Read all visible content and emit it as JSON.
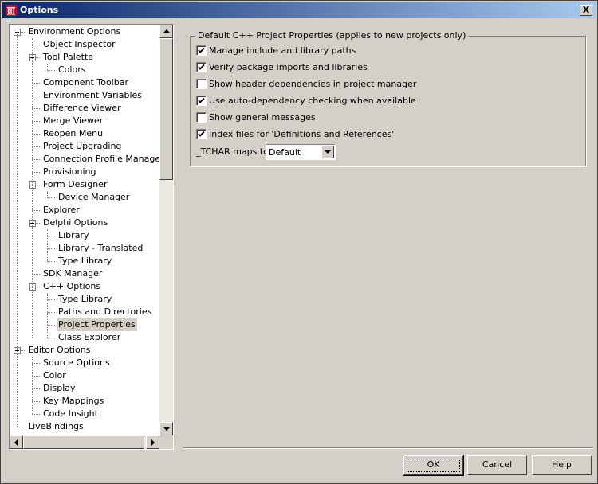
{
  "window": {
    "title": "Options",
    "close_label": "X"
  },
  "tree": {
    "items": [
      {
        "label": "Environment Options",
        "level": 0,
        "expanded": true
      },
      {
        "label": "Object Inspector",
        "level": 1
      },
      {
        "label": "Tool Palette",
        "level": 1,
        "expanded": true
      },
      {
        "label": "Colors",
        "level": 2
      },
      {
        "label": "Component Toolbar",
        "level": 1
      },
      {
        "label": "Environment Variables",
        "level": 1
      },
      {
        "label": "Difference Viewer",
        "level": 1
      },
      {
        "label": "Merge Viewer",
        "level": 1
      },
      {
        "label": "Reopen Menu",
        "level": 1
      },
      {
        "label": "Project Upgrading",
        "level": 1
      },
      {
        "label": "Connection Profile Manager",
        "level": 1
      },
      {
        "label": "Provisioning",
        "level": 1
      },
      {
        "label": "Form Designer",
        "level": 1,
        "expanded": true
      },
      {
        "label": "Device Manager",
        "level": 2
      },
      {
        "label": "Explorer",
        "level": 1
      },
      {
        "label": "Delphi Options",
        "level": 1,
        "expanded": true
      },
      {
        "label": "Library",
        "level": 2
      },
      {
        "label": "Library - Translated",
        "level": 2
      },
      {
        "label": "Type Library",
        "level": 2
      },
      {
        "label": "SDK Manager",
        "level": 1
      },
      {
        "label": "C++ Options",
        "level": 1,
        "expanded": true
      },
      {
        "label": "Type Library",
        "level": 2
      },
      {
        "label": "Paths and Directories",
        "level": 2
      },
      {
        "label": "Project Properties",
        "level": 2,
        "selected": true
      },
      {
        "label": "Class Explorer",
        "level": 2
      },
      {
        "label": "Editor Options",
        "level": 0,
        "expanded": true
      },
      {
        "label": "Source Options",
        "level": 1
      },
      {
        "label": "Color",
        "level": 1
      },
      {
        "label": "Display",
        "level": 1
      },
      {
        "label": "Key Mappings",
        "level": 1
      },
      {
        "label": "Code Insight",
        "level": 1
      },
      {
        "label": "LiveBindings",
        "level": 0
      }
    ]
  },
  "group": {
    "title": "Default C++ Project Properties (applies to new projects only)",
    "checkboxes": [
      {
        "label": "Manage include and library paths",
        "checked": true
      },
      {
        "label": "Verify package imports and libraries",
        "checked": true
      },
      {
        "label": "Show header dependencies in project manager",
        "checked": false
      },
      {
        "label": "Use auto-dependency checking when available",
        "checked": true
      },
      {
        "label": "Show general messages",
        "checked": false
      },
      {
        "label": "Index files for 'Definitions and References'",
        "checked": true
      }
    ],
    "tchar_label": "_TCHAR maps to",
    "tchar_value": "Default"
  },
  "buttons": {
    "ok": "OK",
    "cancel": "Cancel",
    "help": "Help"
  }
}
